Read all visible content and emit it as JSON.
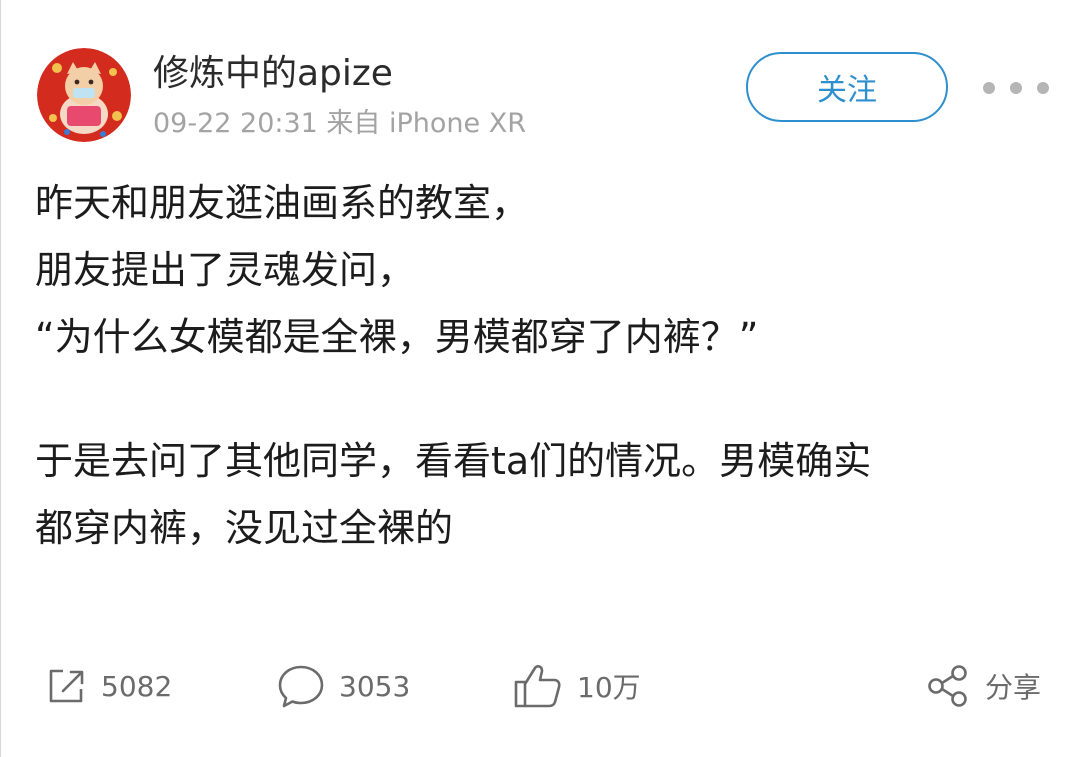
{
  "post": {
    "author": "修炼中的apize",
    "meta": "09-22 20:31 来自 iPhone XR",
    "follow_label": "关注",
    "lines": [
      "昨天和朋友逛油画系的教室，",
      "朋友提出了灵魂发问，",
      "“为什么女模都是全裸，男模都穿了内裤？”",
      "",
      "于是去问了其他同学，看看ta们的情况。男模确实",
      "都穿内裤，没见过全裸的"
    ]
  },
  "actions": {
    "repost_count": "5082",
    "comment_count": "3053",
    "like_count": "10万",
    "share_label": "分享"
  },
  "icons": {
    "avatar": "avatar-illustration",
    "more": "more-dots-icon",
    "repost": "repost-icon",
    "comment": "comment-icon",
    "like": "thumbs-up-icon",
    "share": "share-icon"
  },
  "colors": {
    "accent": "#2e8fcf",
    "text": "#1c1c1c",
    "meta": "#a3a3a3",
    "action": "#6b6b6b"
  }
}
